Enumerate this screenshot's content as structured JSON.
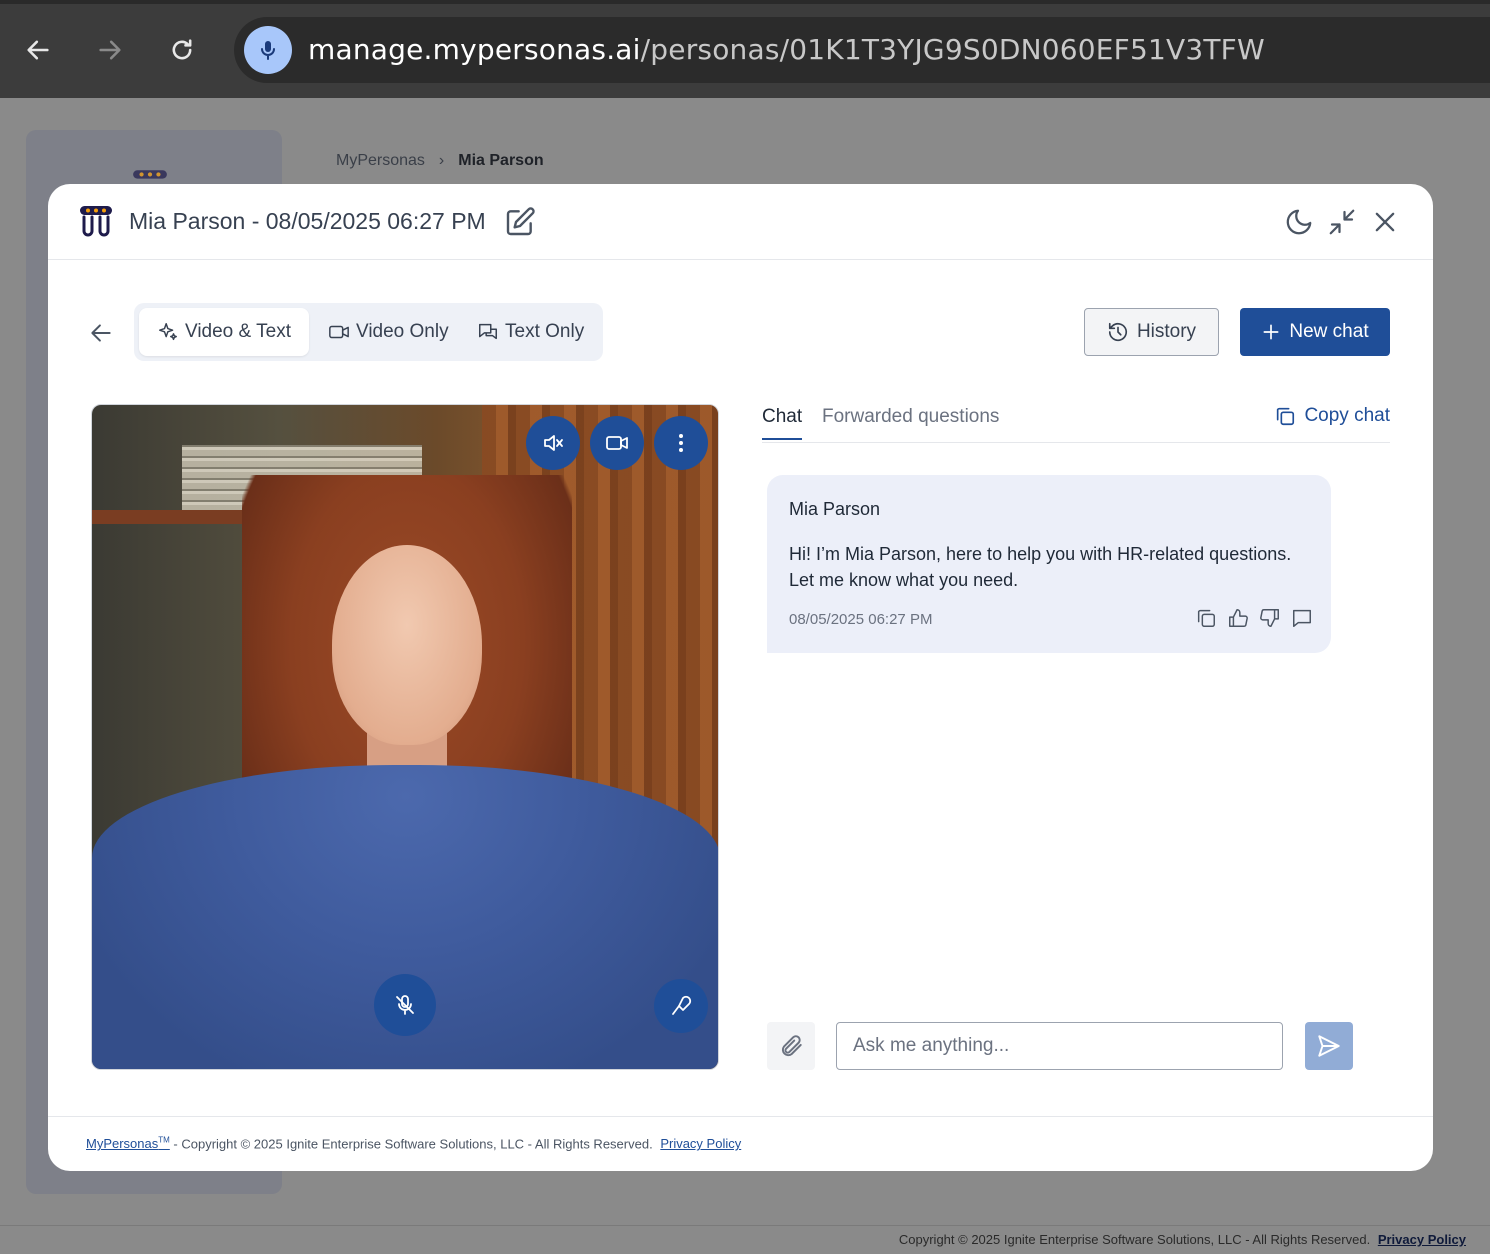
{
  "browser": {
    "url_host": "manage.mypersonas.ai",
    "url_path": "/personas/01K1T3YJG9S0DN060EF51V3TFW"
  },
  "background": {
    "breadcrumb": [
      "MyPersonas",
      "Mia Parson"
    ],
    "footer_text": "Copyright © 2025 Ignite Enterprise Software Solutions, LLC - All Rights Reserved.",
    "footer_link": "Privacy Policy"
  },
  "modal": {
    "title": "Mia Parson - 08/05/2025 06:27 PM",
    "modes": [
      "Video & Text",
      "Video Only",
      "Text Only"
    ],
    "active_mode": "Video & Text",
    "history_label": "History",
    "new_chat_label": "New chat",
    "tabs": [
      "Chat",
      "Forwarded questions"
    ],
    "copy_chat_label": "Copy chat",
    "message": {
      "sender": "Mia Parson",
      "text": "Hi! I’m Mia Parson, here to help you with HR-related questions. Let me know what you need.",
      "time": "08/05/2025 06:27 PM"
    },
    "input_placeholder": "Ask me anything...",
    "footer": {
      "brand": "MyPersonas",
      "trademark": "TM",
      "text": " - Copyright © 2025 Ignite Enterprise Software Solutions, LLC - All Rights Reserved.",
      "privacy": "Privacy Policy"
    }
  },
  "colors": {
    "accent": "#1f4e98",
    "send_disabled": "#91acd6",
    "bubble": "#eceff9"
  }
}
